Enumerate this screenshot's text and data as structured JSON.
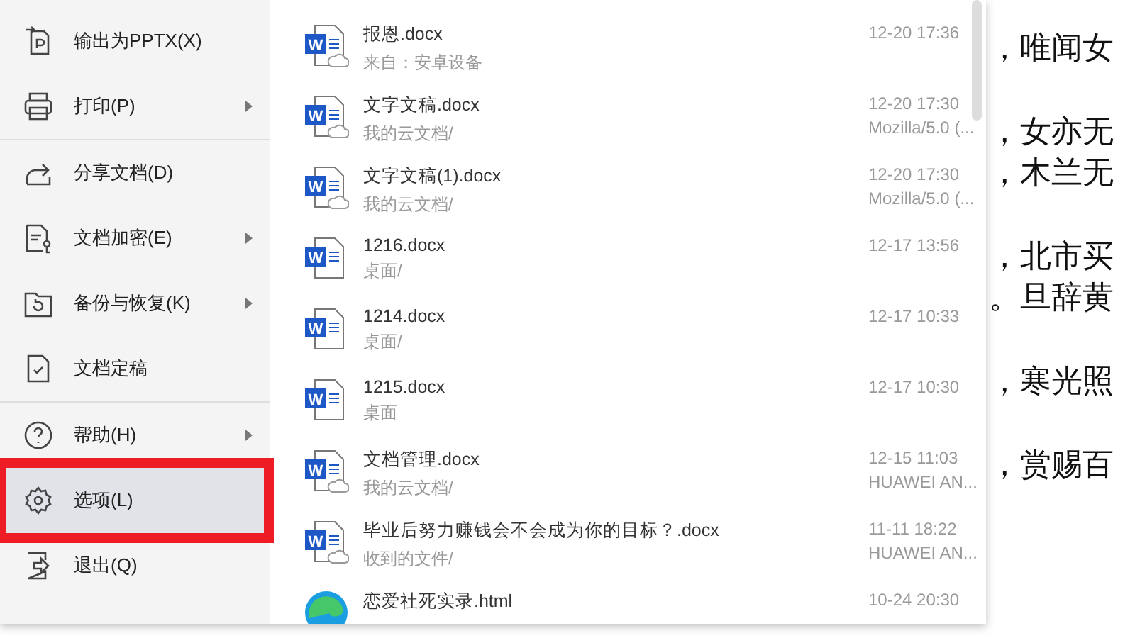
{
  "menu": [
    {
      "kind": "export",
      "label": "输出为PPTX(X)",
      "submenu": false,
      "selected": false,
      "divider_after": false
    },
    {
      "kind": "print",
      "label": "打印(P)",
      "submenu": true,
      "selected": false,
      "divider_after": true
    },
    {
      "kind": "share",
      "label": "分享文档(D)",
      "submenu": false,
      "selected": false,
      "divider_after": false
    },
    {
      "kind": "lock",
      "label": "文档加密(E)",
      "submenu": true,
      "selected": false,
      "divider_after": false
    },
    {
      "kind": "backup",
      "label": "备份与恢复(K)",
      "submenu": true,
      "selected": false,
      "divider_after": false
    },
    {
      "kind": "final",
      "label": "文档定稿",
      "submenu": false,
      "selected": false,
      "divider_after": true
    },
    {
      "kind": "help",
      "label": "帮助(H)",
      "submenu": true,
      "selected": false,
      "divider_after": false
    },
    {
      "kind": "settings",
      "label": "选项(L)",
      "submenu": false,
      "selected": true,
      "annotated": true,
      "divider_after": false
    },
    {
      "kind": "exit",
      "label": "退出(Q)",
      "submenu": false,
      "selected": false,
      "divider_after": false
    }
  ],
  "files": [
    {
      "kind": "word",
      "letter": "W",
      "cloud": true,
      "name": "报恩.docx",
      "location": "来自：安卓设备",
      "time": "12-20 17:36"
    },
    {
      "kind": "word",
      "letter": "W",
      "cloud": true,
      "name": "文字文稿.docx",
      "location": "我的云文档/",
      "time": "12-20 17:30",
      "device": "Mozilla/5.0 (..."
    },
    {
      "kind": "word",
      "letter": "W",
      "cloud": true,
      "name": "文字文稿(1).docx",
      "location": "我的云文档/",
      "time": "12-20 17:30",
      "device": "Mozilla/5.0 (..."
    },
    {
      "kind": "word",
      "letter": "W",
      "cloud": false,
      "name": "1216.docx",
      "location": "桌面/",
      "time": "12-17 13:56"
    },
    {
      "kind": "word",
      "letter": "W",
      "cloud": false,
      "name": "1214.docx",
      "location": "桌面/",
      "time": "12-17 10:33"
    },
    {
      "kind": "word",
      "letter": "W",
      "cloud": false,
      "name": "1215.docx",
      "location": "桌面",
      "time": "12-17 10:30"
    },
    {
      "kind": "word",
      "letter": "W",
      "cloud": true,
      "name": "文档管理.docx",
      "location": "我的云文档/",
      "time": "12-15 11:03",
      "device": "HUAWEI AN..."
    },
    {
      "kind": "word",
      "letter": "W",
      "cloud": true,
      "name": "毕业后努力赚钱会不会成为你的目标？.docx",
      "location": "收到的文件/",
      "time": "11-11 18:22",
      "device": "HUAWEI AN..."
    },
    {
      "kind": "html",
      "name": "恋爱社死实录.html",
      "time": "10-24 20:30"
    }
  ],
  "document": {
    "paragraphs": [
      [
        "，唯闻女"
      ],
      [
        "，女亦无",
        "，木兰无"
      ],
      [
        "，北市买",
        "。旦辞黄"
      ],
      [
        "，寒光照"
      ],
      [
        "，赏赐百"
      ]
    ]
  }
}
